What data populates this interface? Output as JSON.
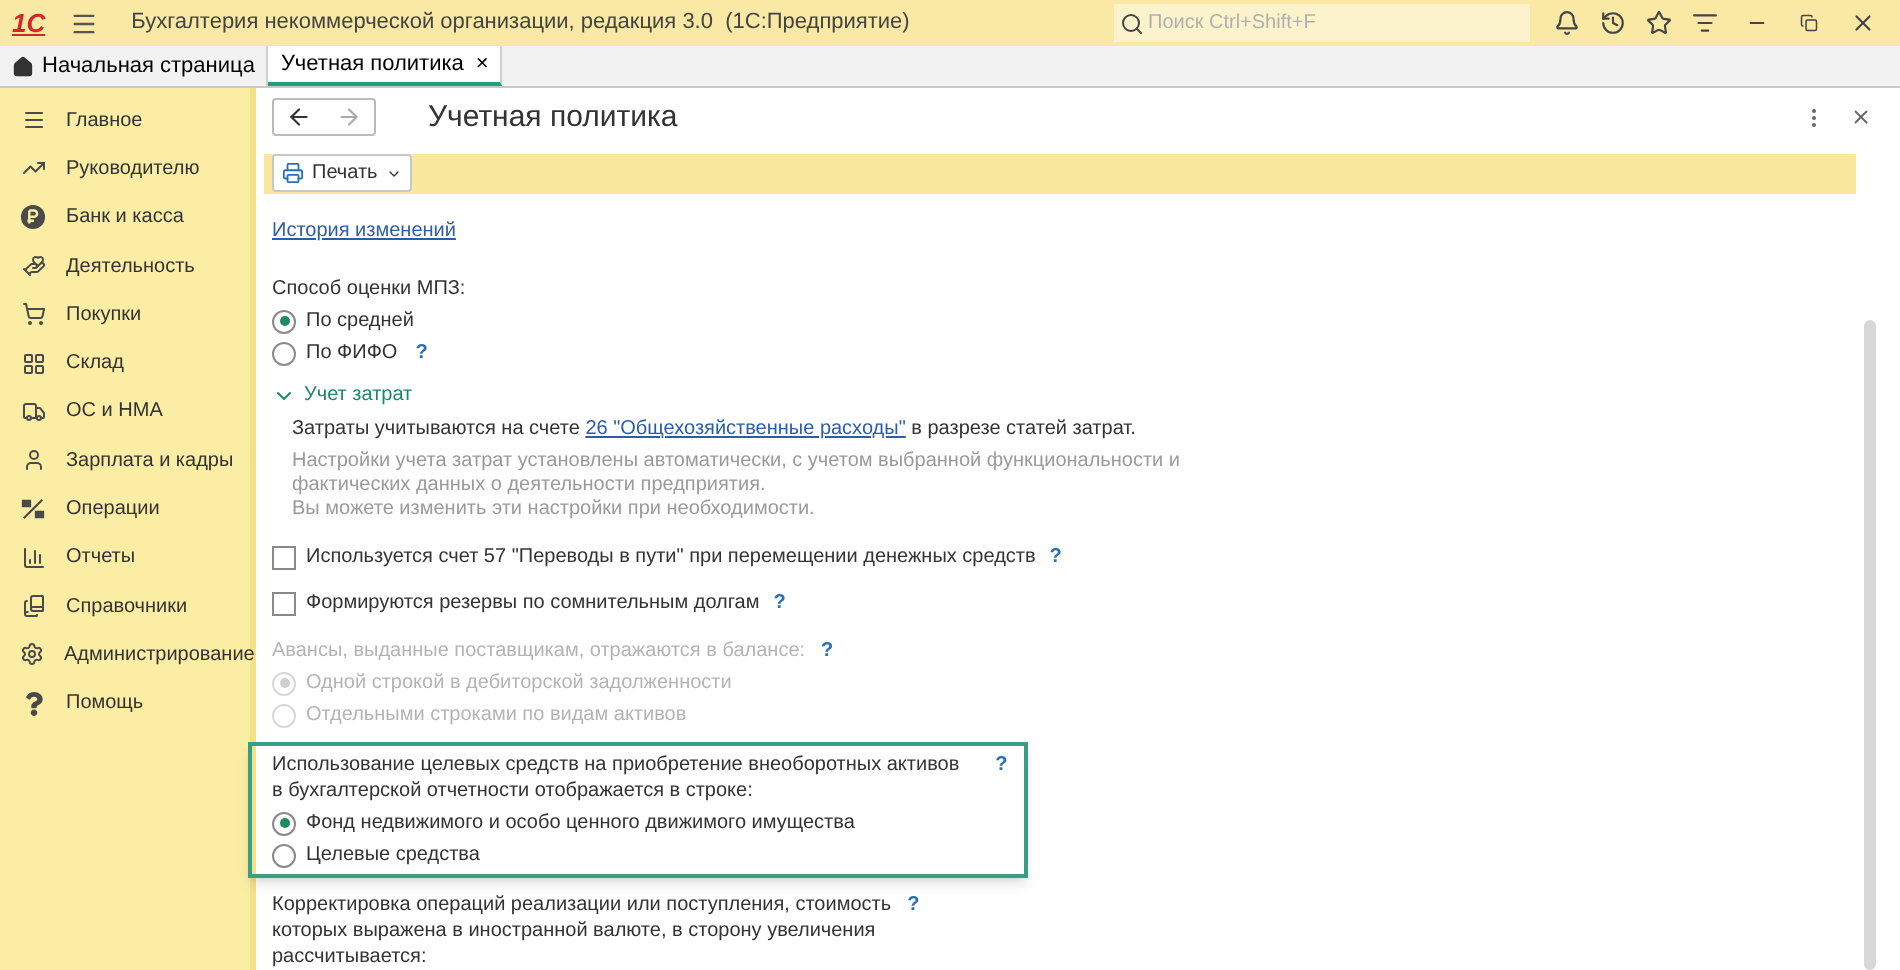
{
  "window": {
    "logo": "1С",
    "title": "Бухгалтерия некоммерческой организации, редакция 3.0  (1С:Предприятие)"
  },
  "search": {
    "placeholder": "Поиск Ctrl+Shift+F"
  },
  "tabs": [
    {
      "label": "Начальная страница",
      "selected": false
    },
    {
      "label": "Учетная политика",
      "selected": true,
      "close": "×"
    }
  ],
  "sidebar": {
    "items": [
      {
        "label": "Главное"
      },
      {
        "label": "Руководителю"
      },
      {
        "label": "Банк и касса"
      },
      {
        "label": "Деятельность"
      },
      {
        "label": "Покупки"
      },
      {
        "label": "Склад"
      },
      {
        "label": "ОС и НМА"
      },
      {
        "label": "Зарплата и кадры"
      },
      {
        "label": "Операции"
      },
      {
        "label": "Отчеты"
      },
      {
        "label": "Справочники"
      },
      {
        "label": "Администрирование"
      },
      {
        "label": "Помощь"
      }
    ]
  },
  "form": {
    "title": "Учетная политика",
    "print_button": "Печать",
    "history_link": "История изменений",
    "sections": [
      {
        "kind": "radio",
        "label": "Способ оценки МПЗ:",
        "disabled": false,
        "options": [
          {
            "label": "По средней",
            "selected": true
          },
          {
            "label": "По ФИФО",
            "selected": false,
            "help": "?"
          }
        ]
      },
      {
        "kind": "expander",
        "label": "Учет затрат",
        "expanded": true,
        "text_before": "Затраты учитываются на счете ",
        "link": "26 \"Общехозяйственные расходы\"",
        "text_after": " в разрезе статей затрат.",
        "note_lines": [
          "Настройки учета затрат установлены автоматически, с учетом выбранной функциональности и",
          "фактических данных о деятельности предприятия.",
          "Вы можете изменить эти настройки при необходимости."
        ]
      },
      {
        "kind": "checkbox",
        "label": "Используется счет 57 \"Переводы в пути\" при перемещении денежных средств",
        "checked": false,
        "help": "?"
      },
      {
        "kind": "checkbox",
        "label": "Формируются резервы по сомнительным долгам",
        "checked": false,
        "help": "?"
      },
      {
        "kind": "radio",
        "label": "Авансы, выданные поставщикам, отражаются в балансе:",
        "help": "?",
        "disabled": true,
        "options": [
          {
            "label": "Одной строкой в дебиторской задолженности",
            "selected": true
          },
          {
            "label": "Отдельными строками по видам активов",
            "selected": false
          }
        ]
      },
      {
        "kind": "radio",
        "label_lines": [
          "Использование целевых средств на приобретение внеоборотных активов",
          "в бухгалтерской отчетности отображается в строке:"
        ],
        "help": "?",
        "disabled": false,
        "highlighted": true,
        "options": [
          {
            "label": "Фонд недвижимого и особо ценного движимого имущества",
            "selected": true
          },
          {
            "label": "Целевые средства",
            "selected": false
          }
        ]
      },
      {
        "kind": "text",
        "label_lines": [
          "Корректировка операций реализации или поступления, стоимость",
          "которых выражена в иностранной валюте, в сторону увеличения",
          "рассчитывается:"
        ],
        "help": "?"
      }
    ]
  }
}
